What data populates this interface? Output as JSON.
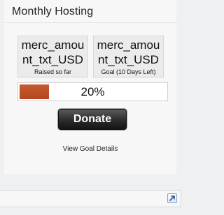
{
  "widget": {
    "title": "Monthly Hosting",
    "raised": {
      "value": "merc_amount_txt_USD",
      "label": "Raised so far"
    },
    "goal": {
      "value": "merc_amount_txt_USD",
      "label": "Goal (10 Days Left)"
    },
    "progress": {
      "percent": 20,
      "text": "20%",
      "fill_color": "#c5592f"
    },
    "donate_label": "Donate",
    "details_link": "View Goal Details"
  },
  "footer": {
    "expand_icon": "external-link-icon"
  }
}
